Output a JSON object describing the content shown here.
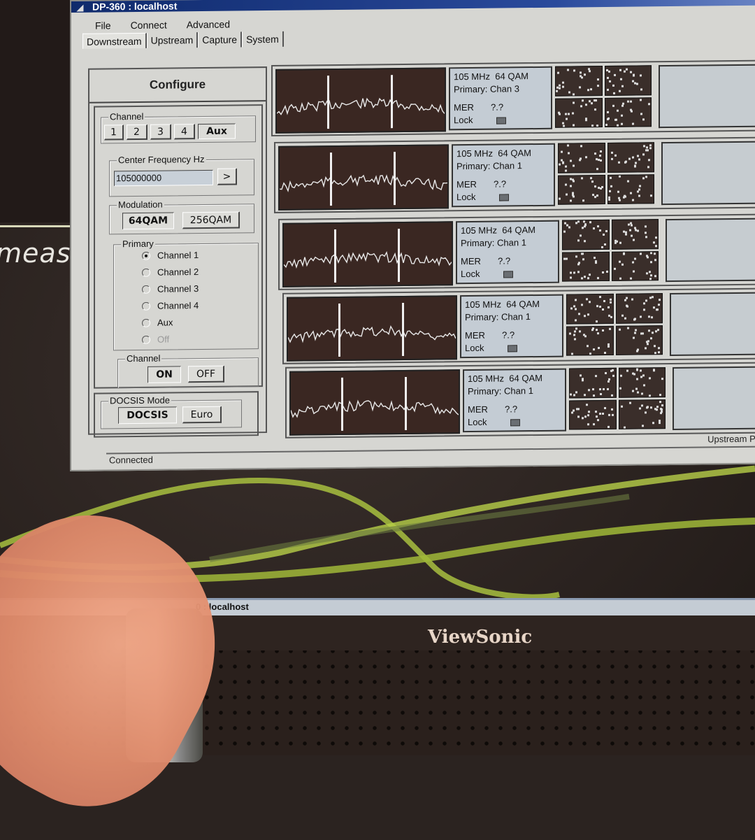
{
  "window": {
    "title": "DP-360 : localhost",
    "menu": [
      "File",
      "Connect",
      "Advanced"
    ],
    "tabs": [
      {
        "label": "Downstream",
        "active": true
      },
      {
        "label": "Upstream",
        "active": false
      },
      {
        "label": "Capture",
        "active": false
      },
      {
        "label": "System",
        "active": false
      }
    ]
  },
  "configure": {
    "title": "Configure",
    "channel_group": {
      "label": "Channel",
      "buttons": [
        "1",
        "2",
        "3",
        "4",
        "Aux"
      ],
      "selected": "Aux"
    },
    "center_frequency": {
      "label": "Center Frequency Hz",
      "value": "105000000",
      "apply_label": ">"
    },
    "modulation": {
      "label": "Modulation",
      "options": [
        "64QAM",
        "256QAM"
      ],
      "selected": "64QAM"
    },
    "primary": {
      "label": "Primary",
      "options": [
        {
          "label": "Channel 1",
          "checked": true,
          "disabled": false
        },
        {
          "label": "Channel 2",
          "checked": false,
          "disabled": false
        },
        {
          "label": "Channel 3",
          "checked": false,
          "disabled": false
        },
        {
          "label": "Channel 4",
          "checked": false,
          "disabled": false
        },
        {
          "label": "Aux",
          "checked": false,
          "disabled": false
        },
        {
          "label": "Off",
          "checked": false,
          "disabled": true
        }
      ]
    },
    "channel_power": {
      "label": "Channel",
      "on_label": "ON",
      "off_label": "OFF",
      "selected": "ON"
    },
    "docsis_mode": {
      "label": "DOCSIS Mode",
      "options": [
        "DOCSIS",
        "Euro"
      ],
      "selected": "DOCSIS"
    }
  },
  "channels": [
    {
      "freq": "105 MHz",
      "mod": "64 QAM",
      "primary": "Primary: Chan 3",
      "mer_label": "MER",
      "mer_value": "?.?",
      "lock_label": "Lock",
      "locked": false
    },
    {
      "freq": "105 MHz",
      "mod": "64 QAM",
      "primary": "Primary: Chan 1",
      "mer_label": "MER",
      "mer_value": "?.?",
      "lock_label": "Lock",
      "locked": false
    },
    {
      "freq": "105 MHz",
      "mod": "64 QAM",
      "primary": "Primary: Chan 1",
      "mer_label": "MER",
      "mer_value": "?.?",
      "lock_label": "Lock",
      "locked": false
    },
    {
      "freq": "105 MHz",
      "mod": "64 QAM",
      "primary": "Primary: Chan 1",
      "mer_label": "MER",
      "mer_value": "?.?",
      "lock_label": "Lock",
      "locked": false
    },
    {
      "freq": "105 MHz",
      "mod": "64 QAM",
      "primary": "Primary: Chan 1",
      "mer_label": "MER",
      "mer_value": "?.?",
      "lock_label": "Lock",
      "locked": false
    }
  ],
  "status": {
    "text": "Connected",
    "upstream_label": "Upstream Po"
  },
  "taskbar": {
    "item": "0 : localhost"
  },
  "desktop": {
    "logo_text": "measu"
  },
  "monitor": {
    "brand": "ViewSonic"
  }
}
